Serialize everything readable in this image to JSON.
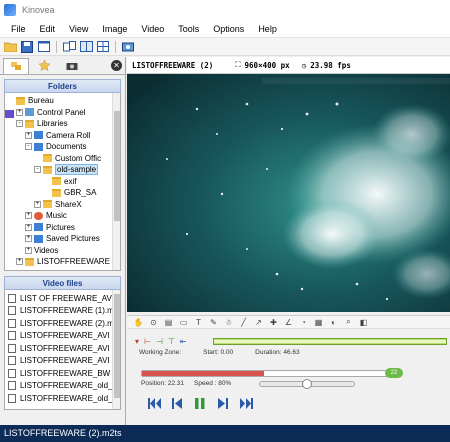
{
  "window": {
    "title": "Kinovea"
  },
  "menu": [
    "File",
    "Edit",
    "View",
    "Image",
    "Video",
    "Tools",
    "Options",
    "Help"
  ],
  "toolbar_icons": [
    "open-folder-icon",
    "save-icon",
    "single-view-icon",
    "split-view-icon",
    "dual-view-icon",
    "grid-view-icon",
    "capture-icon",
    "export-icon"
  ],
  "left_tabs": [
    "explorer-tab-icon",
    "favorites-tab-icon",
    "camera-tab-icon"
  ],
  "folders": {
    "heading": "Folders",
    "tree": [
      {
        "label": "Bureau",
        "depth": 0,
        "icon": "folder",
        "exp": ""
      },
      {
        "label": "Control Panel",
        "depth": 1,
        "icon": "pc",
        "exp": "+"
      },
      {
        "label": "Libraries",
        "depth": 1,
        "icon": "folder",
        "exp": "-"
      },
      {
        "label": "Camera Roll",
        "depth": 2,
        "icon": "blue",
        "exp": "+"
      },
      {
        "label": "Documents",
        "depth": 2,
        "icon": "blue",
        "exp": "-"
      },
      {
        "label": "Custom Offic",
        "depth": 3,
        "icon": "folder",
        "exp": ""
      },
      {
        "label": "old-sample",
        "depth": 3,
        "icon": "folder",
        "exp": "-",
        "selected": true
      },
      {
        "label": "exif",
        "depth": 4,
        "icon": "folder",
        "exp": ""
      },
      {
        "label": "GBR_SA",
        "depth": 4,
        "icon": "folder",
        "exp": ""
      },
      {
        "label": "ShareX",
        "depth": 3,
        "icon": "folder",
        "exp": "+"
      },
      {
        "label": "Music",
        "depth": 2,
        "icon": "music",
        "exp": "+"
      },
      {
        "label": "Pictures",
        "depth": 2,
        "icon": "blue",
        "exp": "+"
      },
      {
        "label": "Saved Pictures",
        "depth": 2,
        "icon": "blue",
        "exp": "+"
      },
      {
        "label": "Videos",
        "depth": 2,
        "icon": "video",
        "exp": "+"
      },
      {
        "label": "LISTOFFREEWARE",
        "depth": 1,
        "icon": "folder",
        "exp": "+"
      }
    ]
  },
  "video_files": {
    "heading": "Video files",
    "items": [
      "LIST OF FREEWARE_AV",
      "LISTOFFREEWARE (1).m",
      "LISTOFFREEWARE (2).m",
      "LISTOFFREEWARE_AVI",
      "LISTOFFREEWARE_AVI",
      "LISTOFFREEWARE_AVI",
      "LISTOFFREEWARE_BW",
      "LISTOFFREEWARE_old_",
      "LISTOFFREEWARE_old_"
    ]
  },
  "player": {
    "filename": "LISTOFFREEWARE (2)",
    "resolution": "960×400 px",
    "fps": "23.98 fps",
    "working_zone_label": "Working Zone:",
    "start_label": "Start: 0.00",
    "duration_label": "Duration: 46.63",
    "position_label": "Position: 22.31",
    "speed_label": "Speed : 80%",
    "position_badge": "22",
    "position_fraction": 0.4784,
    "speed_fraction": 0.5
  },
  "status": {
    "text": "LISTOFFREEWARE (2).m2ts"
  },
  "colors": {
    "statusbar": "#0c2b56",
    "workzone": "#b9e06a",
    "position_fill": "#d9534f"
  }
}
